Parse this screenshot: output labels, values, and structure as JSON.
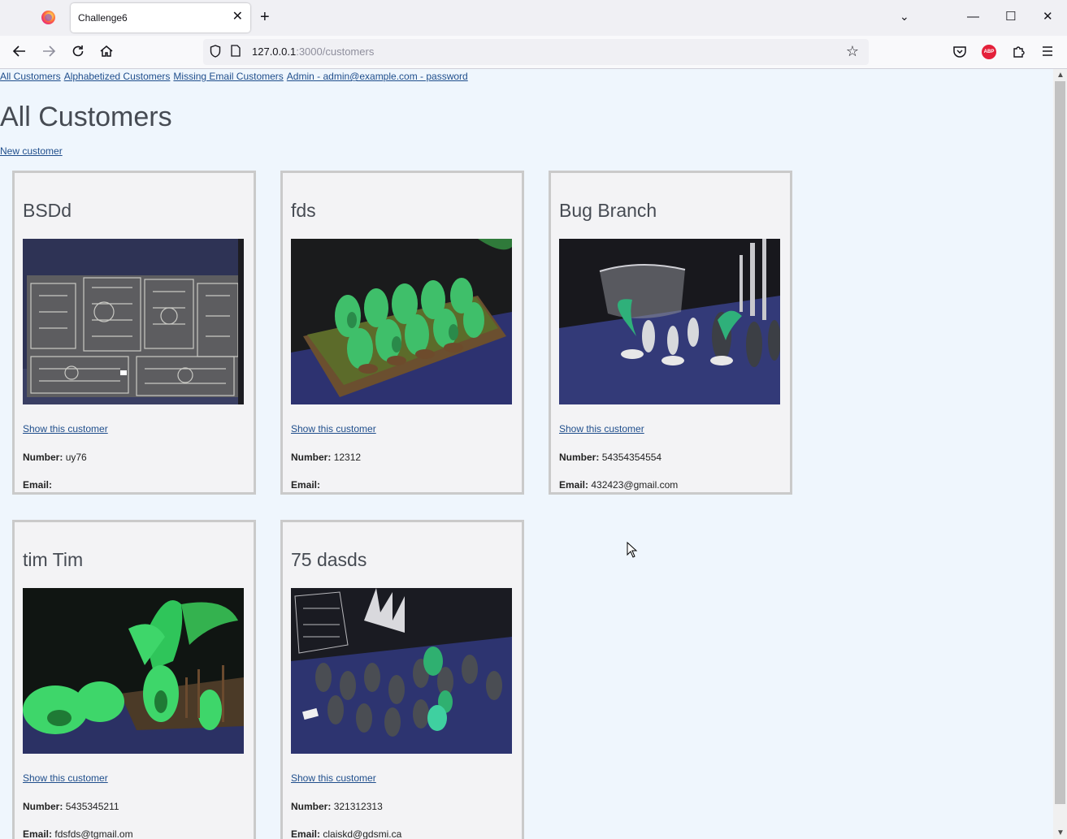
{
  "browser": {
    "tab_title": "Challenge6",
    "tab_close": "✕",
    "new_tab": "+",
    "tab_list": "⌄",
    "url_host": "127.0.0.1",
    "url_rest": ":3000/customers",
    "minimize": "—",
    "maximize": "☐",
    "close": "✕",
    "abp_label": "ABP"
  },
  "nav_links": {
    "all": "All Customers",
    "alpha": "Alphabetized Customers",
    "missing": "Missing Email Customers",
    "admin": "Admin - admin@example.com - password"
  },
  "page": {
    "title": "All Customers",
    "new_customer": "New customer"
  },
  "labels": {
    "show": "Show this customer",
    "number": "Number:",
    "email": "Email:"
  },
  "customers": [
    {
      "name": "BSDd",
      "number": "uy76",
      "email": "",
      "image": "plastic-sprues-photo"
    },
    {
      "name": "fds",
      "number": "12312",
      "email": "",
      "image": "green-miniatures-on-base-photo"
    },
    {
      "name": "Bug Branch",
      "number": "54354354554",
      "email": "432423@gmail.com",
      "image": "miniatures-and-plastic-bowl-photo"
    },
    {
      "name": "tim Tim",
      "number": "5435345211",
      "email": "fdsfds@tgmail.om",
      "image": "green-dragon-miniatures-photo"
    },
    {
      "name": "75 dasds",
      "number": "321312313",
      "email": "claiskd@gdsmi.ca",
      "image": "grey-miniatures-on-table-photo"
    }
  ]
}
